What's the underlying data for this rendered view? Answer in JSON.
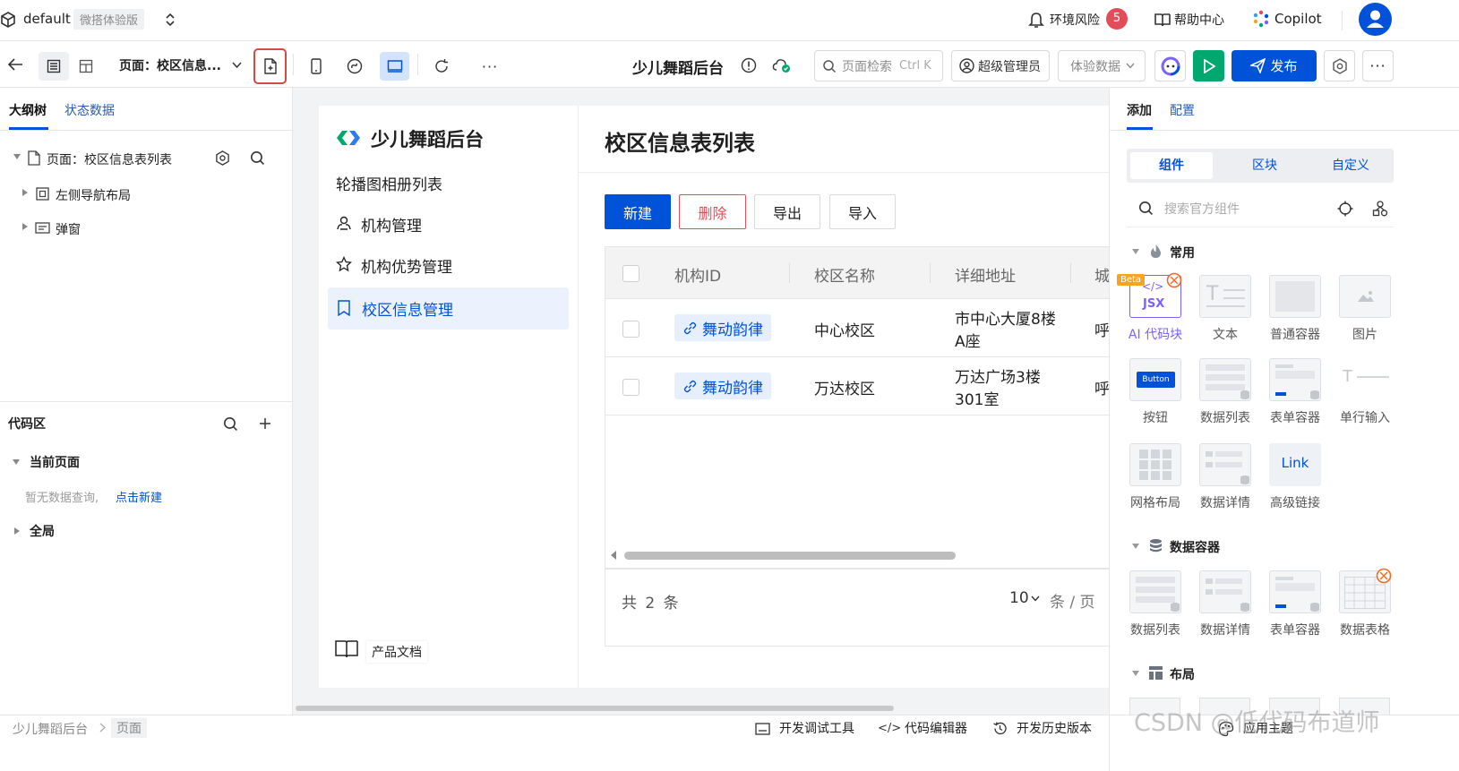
{
  "topbar": {
    "app_name": "default",
    "edition_badge": "微搭体验版",
    "env_risk_label": "环境风险",
    "env_risk_count": "5",
    "help_label": "帮助中心",
    "copilot_label": "Copilot"
  },
  "toolbar": {
    "page_select_label": "页面：校区信息...",
    "app_title": "少儿舞蹈后台",
    "search_placeholder": "页面检索",
    "search_shortcut": "Ctrl K",
    "role_label": "超级管理员",
    "data_mode_label": "体验数据",
    "publish_label": "发布"
  },
  "outline": {
    "tabs": [
      "大纲树",
      "状态数据"
    ],
    "page_node": "页面：校区信息表列表",
    "children": [
      "左侧导航布局",
      "弹窗"
    ]
  },
  "code_area": {
    "title": "代码区",
    "current_page": "当前页面",
    "empty_text": "暂无数据查询,",
    "create_link": "点击新建",
    "global": "全局"
  },
  "app_preview": {
    "logo_text": "少儿舞蹈后台",
    "nav": [
      "轮播图相册列表",
      "机构管理",
      "机构优势管理",
      "校区信息管理"
    ],
    "footer_doc": "产品文档",
    "page_title": "校区信息表列表",
    "buttons": {
      "new": "新建",
      "delete": "删除",
      "export": "导出",
      "import": "导入"
    },
    "table": {
      "headers": [
        "机构ID",
        "校区名称",
        "详细地址",
        "城"
      ],
      "rows": [
        {
          "org": "舞动韵律",
          "name": "中心校区",
          "addr1": "市中心大厦8楼",
          "addr2": "A座",
          "city": "呼"
        },
        {
          "org": "舞动韵律",
          "name": "万达校区",
          "addr1": "万达广场3楼",
          "addr2": "301室",
          "city": "呼"
        }
      ]
    },
    "pagination": {
      "total_prefix": "共",
      "total": "2",
      "total_suffix": "条",
      "page_size": "10",
      "page_unit": "条 / 页"
    }
  },
  "right_panel": {
    "tabs": [
      "添加",
      "配置"
    ],
    "segments": [
      "组件",
      "区块",
      "自定义"
    ],
    "search_placeholder": "搜索官方组件",
    "group_common": "常用",
    "common_items": [
      "AI 代码块",
      "文本",
      "普通容器",
      "图片",
      "按钮",
      "数据列表",
      "表单容器",
      "单行输入",
      "网格布局",
      "数据详情",
      "高级链接"
    ],
    "beta_badge": "Beta",
    "jsx_label": "JSX",
    "button_preview": "Button",
    "link_preview": "Link",
    "group_data": "数据容器",
    "data_items": [
      "数据列表",
      "数据详情",
      "表单容器",
      "数据表格"
    ],
    "group_layout": "布局"
  },
  "statusbar": {
    "breadcrumb": [
      "少儿舞蹈后台",
      "页面"
    ],
    "devtools": "开发调试工具",
    "code_editor": "代码编辑器",
    "history": "开发历史版本",
    "theme": "应用主题",
    "watermark": "CSDN @低代码布道师"
  },
  "colors": {
    "primary": "#0052d9",
    "publish": "#0052d9",
    "run": "#00a870",
    "danger": "#e34d59",
    "highlight": "#d54941",
    "nav_active_bg": "#ebf1fd"
  }
}
